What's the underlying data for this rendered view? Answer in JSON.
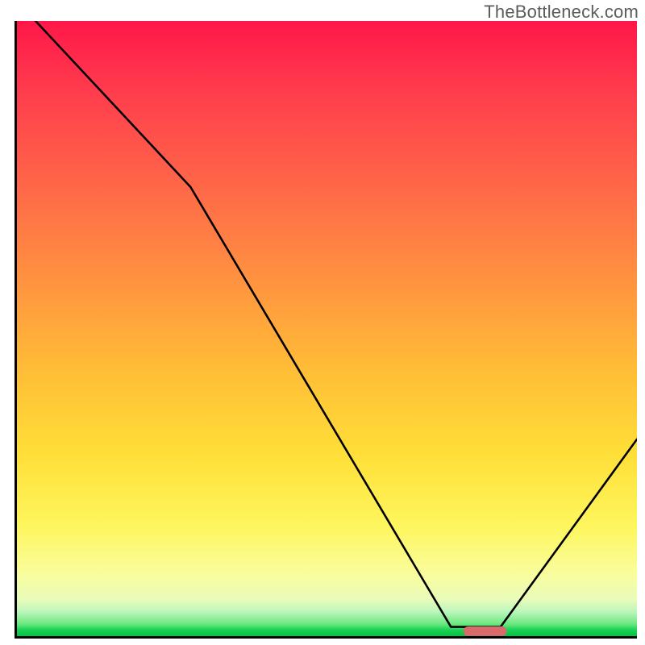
{
  "watermark": "TheBottleneck.com",
  "chart_data": {
    "type": "line",
    "title": "",
    "xlabel": "",
    "ylabel": "",
    "xlim": [
      0,
      100
    ],
    "ylim": [
      0,
      100
    ],
    "grid": false,
    "annotations": [
      {
        "text": "TheBottleneck.com",
        "position": "top-right"
      }
    ],
    "series": [
      {
        "name": "bottleneck-curve",
        "x": [
          3,
          28,
          70,
          78,
          100
        ],
        "values": [
          100,
          73,
          1.5,
          1.5,
          32
        ],
        "note": "piecewise: steep-ish drop, kink near x≈28, long near-linear descent to a short flat trough around x≈70–78, then rise"
      }
    ],
    "marker": {
      "name": "optimal-range",
      "shape": "rounded-bar",
      "color": "#d96a6a",
      "x_start": 72,
      "x_end": 79,
      "y": 0.8
    },
    "gradient_background": {
      "orientation": "vertical",
      "stops": [
        {
          "pos": 0.0,
          "color": "#ff1749"
        },
        {
          "pos": 0.5,
          "color": "#ffae3a"
        },
        {
          "pos": 0.82,
          "color": "#fef65d"
        },
        {
          "pos": 0.98,
          "color": "#6de87f"
        },
        {
          "pos": 1.0,
          "color": "#03c33e"
        }
      ]
    }
  }
}
